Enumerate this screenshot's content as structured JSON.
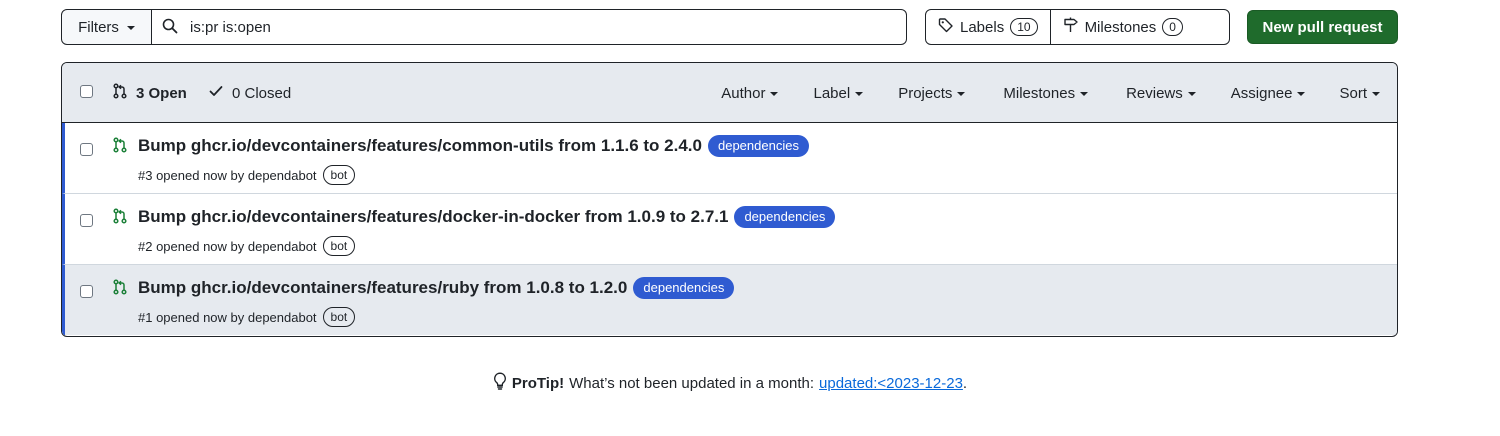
{
  "toolbar": {
    "filters_label": "Filters",
    "search_value": "is:pr is:open",
    "labels_label": "Labels",
    "labels_count": "10",
    "milestones_label": "Milestones",
    "milestones_count": "0",
    "new_pr_label": "New pull request"
  },
  "list_header": {
    "open_label": "3 Open",
    "closed_label": "0 Closed",
    "filters": [
      "Author",
      "Label",
      "Projects",
      "Milestones",
      "Reviews",
      "Assignee",
      "Sort"
    ]
  },
  "pull_requests": [
    {
      "title": "Bump ghcr.io/devcontainers/features/common-utils from 1.1.6 to 2.4.0",
      "label": "dependencies",
      "meta": "#3 opened now by dependabot",
      "badge": "bot"
    },
    {
      "title": "Bump ghcr.io/devcontainers/features/docker-in-docker from 1.0.9 to 2.7.1",
      "label": "dependencies",
      "meta": "#2 opened now by dependabot",
      "badge": "bot"
    },
    {
      "title": "Bump ghcr.io/devcontainers/features/ruby from 1.0.8 to 1.2.0",
      "label": "dependencies",
      "meta": "#1 opened now by dependabot",
      "badge": "bot"
    }
  ],
  "protip": {
    "strong": "ProTip!",
    "text": "What’s not been updated in a month:",
    "link": "updated:<2023-12-23",
    "trail": "."
  },
  "colors": {
    "accent_green": "#1f6b2c",
    "label_blue": "#2f5bd1",
    "pr_open_green": "#1a7f37",
    "link_blue": "#0969da"
  },
  "icons": {
    "search": "search-icon",
    "tag": "tag-icon",
    "milestone": "milestone-icon",
    "pr_open": "pull-request-icon",
    "check": "check-icon",
    "lightbulb": "lightbulb-icon"
  }
}
